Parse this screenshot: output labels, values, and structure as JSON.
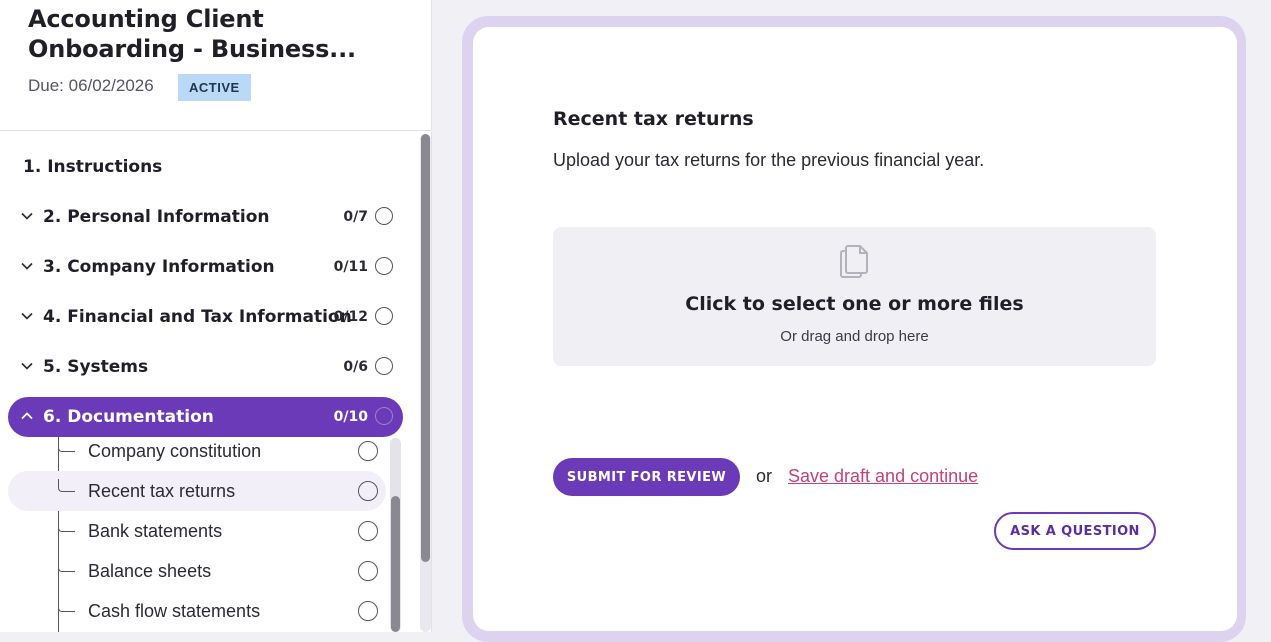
{
  "sidebar": {
    "title": "Accounting Client Onboarding - Business...",
    "due": "Due: 06/02/2026",
    "status_badge": "ACTIVE",
    "instructions_label": "1. Instructions",
    "sections": [
      {
        "label": "2. Personal Information",
        "count": "0/7"
      },
      {
        "label": "3. Company Information",
        "count": "0/11"
      },
      {
        "label": "4. Financial and Tax Information",
        "count": "0/12"
      },
      {
        "label": "5. Systems",
        "count": "0/6"
      },
      {
        "label": "6. Documentation",
        "count": "0/10",
        "expanded": true
      }
    ],
    "documentation_items": [
      {
        "label": "Company constitution"
      },
      {
        "label": "Recent tax returns",
        "selected": true
      },
      {
        "label": "Bank statements"
      },
      {
        "label": "Balance sheets"
      },
      {
        "label": "Cash flow statements"
      }
    ]
  },
  "main": {
    "question_title": "Recent tax returns",
    "question_description": "Upload your tax returns for the previous financial year.",
    "dropzone": {
      "icon": "copy-files-icon",
      "main_text": "Click to select one or more files",
      "sub_text": "Or drag and drop here"
    },
    "submit_label": "SUBMIT FOR REVIEW",
    "or_text": "or",
    "save_draft_label": "Save draft and continue",
    "ask_question_label": "ASK A QUESTION"
  },
  "colors": {
    "accent": "#6b3ab8",
    "link": "#c2417a",
    "badge_bg": "#b9d9f7",
    "card_border": "#ddd3f1"
  }
}
